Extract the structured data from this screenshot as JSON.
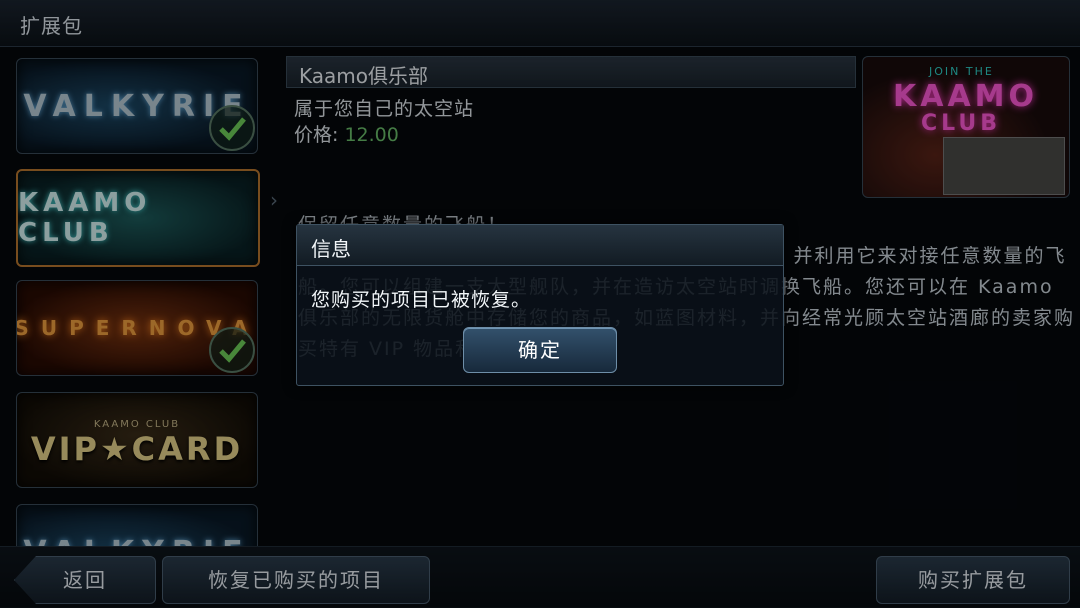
{
  "header": {
    "title": "扩展包"
  },
  "sidebar": {
    "packs": [
      {
        "label": "VALKYRIE",
        "owned": true
      },
      {
        "label": "KAAMO CLUB",
        "selected": true
      },
      {
        "label": "SUPERNOVA",
        "owned": true
      },
      {
        "label": "VIP★CARD",
        "sub": "KAAMO CLUB"
      },
      {
        "label": "VALKYRIE"
      }
    ]
  },
  "product": {
    "name": "Kaamo俱乐部",
    "subtitle": "属于您自己的太空站",
    "price_label": "价格:",
    "price_value": "12.00",
    "description": [
      "保留任意数量的飞船！",
      "购买您自己的太空站，即声名狼藉的Kaamo俱乐部，并利用它来对接任意数量的飞船。您可以组建一支大型舰队，并在造访太空站时调换飞船。您还可以在 Kaamo",
      "俱乐部的无限货舱中存储您的商品，如蓝图材料，并向经常光顾太空站酒廊的卖家购买特有 VIP 物品和定制产品。"
    ]
  },
  "preview": {
    "line1": "JOIN THE",
    "line2": "KAAMO",
    "line3": "CLUB"
  },
  "dialog": {
    "title": "信息",
    "message": "您购买的项目已被恢复。",
    "ok_label": "确定"
  },
  "footer": {
    "back_label": "返回",
    "restore_label": "恢复已购买的项目",
    "buy_label": "购买扩展包"
  },
  "colors": {
    "price": "#6bbf6b",
    "selected_border": "#b9772f"
  }
}
